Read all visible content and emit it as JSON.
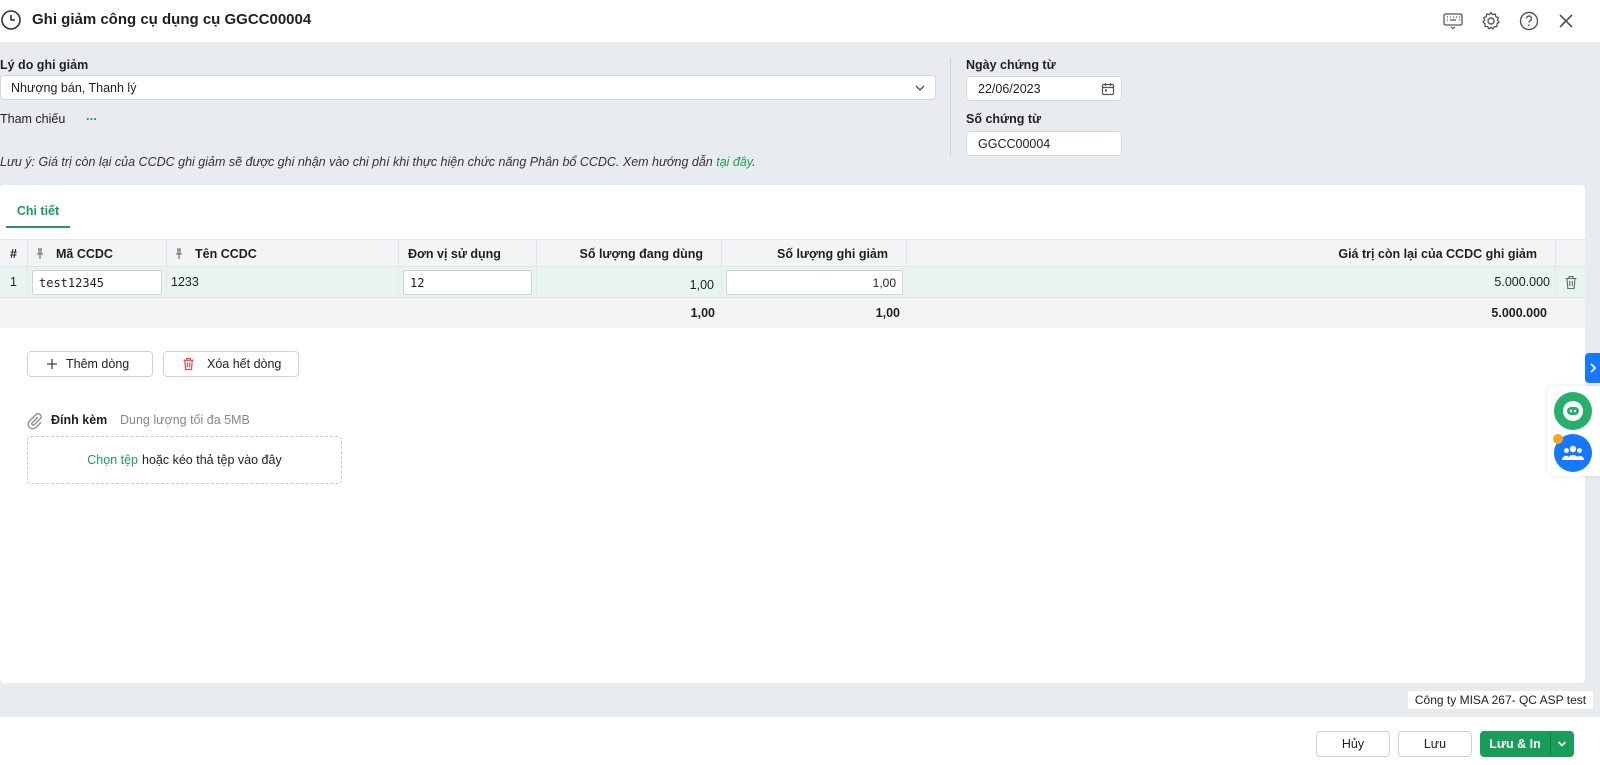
{
  "window": {
    "title": "Ghi giảm công cụ dụng cụ GGCC00004",
    "icons": [
      "history-icon",
      "keyboard-icon",
      "gear-icon",
      "help-icon",
      "close-icon"
    ]
  },
  "form": {
    "reason_label": "Lý do ghi giảm",
    "reason_value": "Nhượng bán, Thanh lý",
    "reference_label": "Tham chiếu",
    "reference_more": "...",
    "date_label": "Ngày chứng từ",
    "date_value": "22/06/2023",
    "number_label": "Số chứng từ",
    "number_value": "GGCC00004",
    "note_text": "Lưu ý: Giá trị còn lại của CCDC ghi giảm sẽ được ghi nhận vào chi phí khi thực hiện chức năng Phân bổ CCDC. Xem hướng dẫn",
    "note_link": "tại đây",
    "note_end": "."
  },
  "tabs": [
    {
      "label": "Chi tiết",
      "active": true
    }
  ],
  "table": {
    "columns": {
      "index": "#",
      "code": "Mã CCDC",
      "name": "Tên CCDC",
      "unit": "Đơn vị sử dụng",
      "qty_in_use": "Số lượng đang dùng",
      "qty_decrease": "Số lượng ghi giảm",
      "remaining_value": "Giá trị còn lại của CCDC ghi giảm"
    },
    "rows": [
      {
        "index": "1",
        "code": "test12345",
        "name": "1233",
        "unit": "12",
        "qty_in_use": "1,00",
        "qty_decrease": "1,00",
        "remaining_value": "5.000.000"
      }
    ],
    "totals": {
      "qty_in_use": "1,00",
      "qty_decrease": "1,00",
      "remaining_value": "5.000.000"
    }
  },
  "actions": {
    "add_row": "Thêm dòng",
    "delete_all": "Xóa hết dòng"
  },
  "attachment": {
    "label": "Đính kèm",
    "hint": "Dung lượng tối đa 5MB",
    "choose": "Chọn tệp",
    "drop_text": "hoặc kéo thả tệp vào đây"
  },
  "company": "Công ty MISA 267- QC ASP test",
  "footer": {
    "cancel": "Hủy",
    "save": "Lưu",
    "save_print": "Lưu & In"
  },
  "colors": {
    "accent": "#1a9c5b",
    "danger": "#e5484d",
    "side_tab": "#1677ff"
  }
}
